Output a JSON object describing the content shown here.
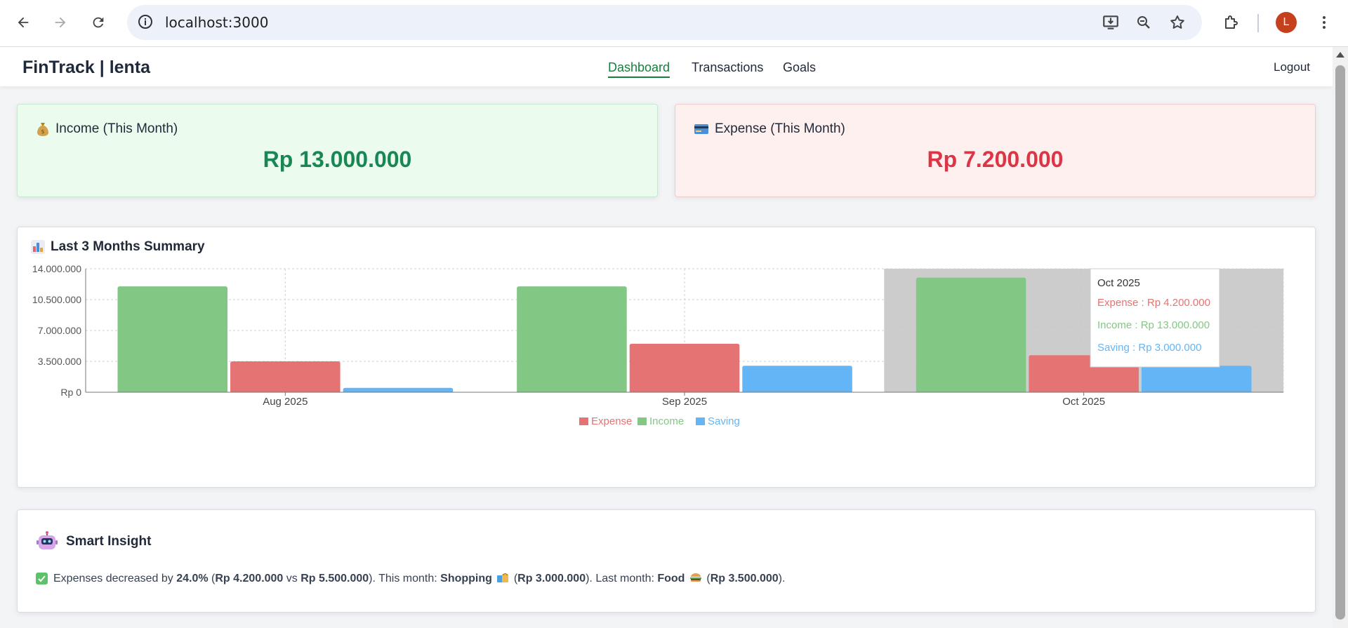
{
  "browser": {
    "url": "localhost:3000",
    "avatar_letter": "L"
  },
  "app": {
    "brand": "FinTrack | lenta",
    "nav": [
      {
        "label": "Dashboard",
        "active": true
      },
      {
        "label": "Transactions",
        "active": false
      },
      {
        "label": "Goals",
        "active": false
      }
    ],
    "logout": "Logout"
  },
  "summary": {
    "income": {
      "label": "Income (This Month)",
      "amount": "Rp 13.000.000",
      "icon": "money-bag-icon"
    },
    "expense": {
      "label": "Expense (This Month)",
      "amount": "Rp 7.200.000",
      "icon": "credit-card-icon"
    }
  },
  "chart_section": {
    "title": "Last 3 Months Summary",
    "icon": "bar-chart-icon"
  },
  "chart_data": {
    "type": "bar",
    "categories": [
      "Aug 2025",
      "Sep 2025",
      "Oct 2025"
    ],
    "series": [
      {
        "name": "Income",
        "color": "#82c884",
        "values": [
          12000000,
          12000000,
          13000000
        ]
      },
      {
        "name": "Expense",
        "color": "#e57373",
        "values": [
          3500000,
          5500000,
          4200000
        ]
      },
      {
        "name": "Saving",
        "color": "#64b5f6",
        "values": [
          500000,
          3000000,
          3000000
        ]
      }
    ],
    "legend_order": [
      "Expense",
      "Income",
      "Saving"
    ],
    "yticks": [
      "Rp 0",
      "3.500.000",
      "7.000.000",
      "10.500.000",
      "14.000.000"
    ],
    "ylim": [
      0,
      14000000
    ],
    "grid": true,
    "legend": "bottom-center",
    "highlighted_category": "Oct 2025",
    "tooltip": {
      "title": "Oct 2025",
      "lines": [
        {
          "text": "Expense : Rp 4.200.000",
          "color": "#e57373"
        },
        {
          "text": "Income : Rp 13.000.000",
          "color": "#82c884"
        },
        {
          "text": "Saving : Rp 3.000.000",
          "color": "#64b5f6"
        }
      ]
    }
  },
  "insight": {
    "title": "Smart Insight",
    "text": {
      "p1": "Expenses decreased by ",
      "pct": "24.0%",
      "p2": " (",
      "cur": "Rp 4.200.000",
      "p3": " vs ",
      "prev": "Rp 5.500.000",
      "p4": "). This month: ",
      "cat1": "Shopping",
      "p5": " (",
      "amt1": "Rp 3.000.000",
      "p6": "). Last month: ",
      "cat2": "Food",
      "p7": " (",
      "amt2": "Rp 3.500.000",
      "p8": ")."
    }
  }
}
